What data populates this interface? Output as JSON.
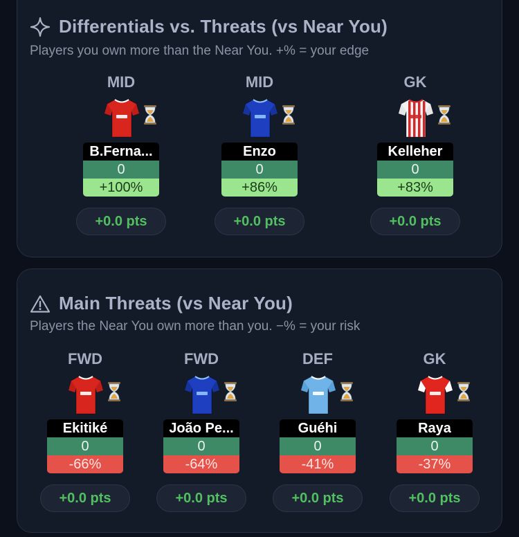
{
  "differentials": {
    "title": "Differentials vs. Threats (vs Near You)",
    "subtitle": "Players you own more than the Near You. +% = your edge",
    "players": [
      {
        "position": "MID",
        "name": "B.Ferna...",
        "points": "0",
        "pct": "+100%",
        "pts_label": "+0.0 pts",
        "shirt": {
          "body": "#d8261f",
          "sleeve": "#c11d18",
          "trim": "#ffffff",
          "stripes": false
        }
      },
      {
        "position": "MID",
        "name": "Enzo",
        "points": "0",
        "pct": "+86%",
        "pts_label": "+0.0 pts",
        "shirt": {
          "body": "#1e3fbf",
          "sleeve": "#17329b",
          "trim": "#8fc4ff",
          "stripes": false
        }
      },
      {
        "position": "GK",
        "name": "Kelleher",
        "points": "0",
        "pct": "+83%",
        "pts_label": "+0.0 pts",
        "shirt": {
          "body": "#f3f3f3",
          "sleeve": "#e6e6e6",
          "trim": "#d22a2a",
          "stripes": true
        }
      }
    ]
  },
  "threats": {
    "title": "Main Threats (vs Near You)",
    "subtitle": "Players the Near You own more than you. −% = your risk",
    "players": [
      {
        "position": "FWD",
        "name": "Ekitiké",
        "points": "0",
        "pct": "-66%",
        "pts_label": "+0.0 pts",
        "shirt": {
          "body": "#d8261f",
          "sleeve": "#c11d18",
          "trim": "#ffffff",
          "stripes": false
        }
      },
      {
        "position": "FWD",
        "name": "João Pe...",
        "points": "0",
        "pct": "-64%",
        "pts_label": "+0.0 pts",
        "shirt": {
          "body": "#1e3fbf",
          "sleeve": "#17329b",
          "trim": "#8fc4ff",
          "stripes": false
        }
      },
      {
        "position": "DEF",
        "name": "Guéhi",
        "points": "0",
        "pct": "-41%",
        "pts_label": "+0.0 pts",
        "shirt": {
          "body": "#6fb3e8",
          "sleeve": "#5aa1da",
          "trim": "#ffffff",
          "stripes": false
        }
      },
      {
        "position": "GK",
        "name": "Raya",
        "points": "0",
        "pct": "-37%",
        "pts_label": "+0.0 pts",
        "shirt": {
          "body": "#e1261f",
          "sleeve": "#ffffff",
          "trim": "#ffffff",
          "stripes": false
        }
      }
    ]
  },
  "icons": {
    "differentials": "sparkle-icon",
    "threats": "warning-triangle-icon",
    "status": "hourglass-icon"
  },
  "colors": {
    "edge_bg": "#9ce58f",
    "risk_bg": "#e5524a",
    "points_bg": "#3e8a67",
    "pts_text": "#52bf61"
  }
}
